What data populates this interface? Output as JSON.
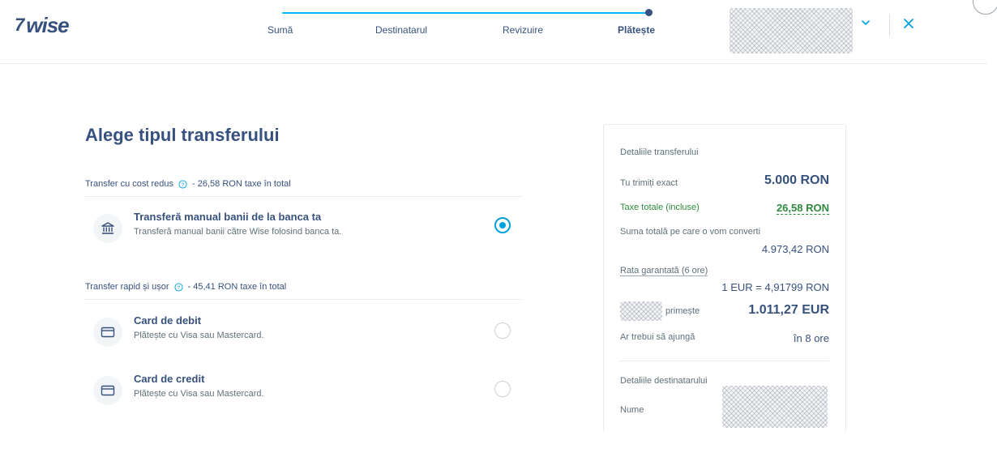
{
  "brand": {
    "logo_flag": "7",
    "logo_word": "wise"
  },
  "steps": [
    {
      "label": "Sumă"
    },
    {
      "label": "Destinatarul"
    },
    {
      "label": "Revizuire"
    },
    {
      "label": "Plătește"
    }
  ],
  "active_step": "Plătește",
  "icons": {
    "dropdown": "chevron-down-icon",
    "close": "close-icon",
    "help": "question-icon",
    "bank": "bank-icon",
    "card": "card-icon"
  },
  "colors": {
    "accent": "#00b9ff",
    "primary_text": "#37517e",
    "fee_green": "#2e8b3e",
    "radio": "#00a2dd"
  },
  "page": {
    "title": "Alege tipul transferului"
  },
  "sections": [
    {
      "label": "Transfer cu cost redus",
      "fee": "- 26,58 RON taxe în total",
      "options": [
        {
          "title": "Transferă manual banii de la banca ta",
          "subtitle": "Transferă manual banii către Wise folosind banca ta.",
          "selected": true
        }
      ]
    },
    {
      "label": "Transfer rapid și ușor",
      "fee": "- 45,41 RON taxe în total",
      "options": [
        {
          "title": "Card de debit",
          "subtitle": "Plătește cu Visa sau Mastercard.",
          "selected": false
        },
        {
          "title": "Card de credit",
          "subtitle": "Plătește cu Visa sau Mastercard.",
          "selected": false
        }
      ]
    }
  ],
  "details": {
    "title": "Detaliile transferului",
    "send_label": "Tu trimiți exact",
    "send_value": "5.000 RON",
    "fees_label": "Taxe totale (incluse)",
    "fees_value": "26,58 RON",
    "converted_label": "Suma totală pe care o vom converti",
    "converted_value": "4.973,42 RON",
    "rate_label": "Rata garantată (6 ore)",
    "rate_value": "1 EUR = 4,91799 RON",
    "receive_label": "primește",
    "receive_value": "1.011,27 EUR",
    "arrive_label": "Ar trebui să ajungă",
    "arrive_value": "în 8 ore",
    "recipient_title": "Detaliile destinatarului",
    "name_label": "Nume"
  }
}
